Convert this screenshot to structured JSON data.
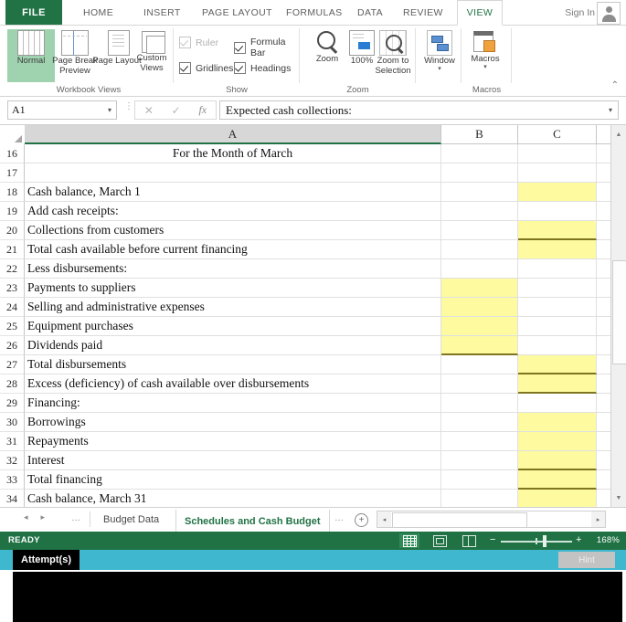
{
  "window": {
    "ribbon_tabs": [
      "FILE",
      "HOME",
      "INSERT",
      "PAGE LAYOUT",
      "FORMULAS",
      "DATA",
      "REVIEW",
      "VIEW"
    ],
    "active_ribbon_tab": "VIEW",
    "sign_in": "Sign In",
    "account_icon": "account-person-icon"
  },
  "ribbon": {
    "groups": [
      {
        "name": "Workbook Views",
        "label": "Workbook Views"
      },
      {
        "name": "Show",
        "label": "Show"
      },
      {
        "name": "Zoom",
        "label": "Zoom"
      },
      {
        "name": "Macros",
        "label": "Macros"
      }
    ],
    "workbook_views": [
      {
        "label": "Normal",
        "icon": "normal-view-icon",
        "selected": true
      },
      {
        "label": "Page Break Preview",
        "icon": "page-break-preview-icon",
        "selected": false
      },
      {
        "label": "Page Layout",
        "icon": "page-layout-icon",
        "selected": false
      },
      {
        "label": "Custom Views",
        "icon": "custom-views-icon",
        "selected": false
      }
    ],
    "show_checkboxes": [
      {
        "label": "Ruler",
        "checked": true,
        "disabled": true
      },
      {
        "label": "Formula Bar",
        "checked": true,
        "disabled": false
      },
      {
        "label": "Gridlines",
        "checked": true,
        "disabled": false
      },
      {
        "label": "Headings",
        "checked": true,
        "disabled": false
      }
    ],
    "zoom_buttons": [
      {
        "label": "Zoom",
        "icon": "magnifier-icon"
      },
      {
        "label": "100%",
        "icon": "zoom-100-icon"
      },
      {
        "label": "Zoom to Selection",
        "icon": "zoom-to-selection-icon"
      }
    ],
    "window_button": {
      "label": "Window",
      "icon": "window-icon",
      "caret": "▾"
    },
    "macros_button": {
      "label": "Macros",
      "icon": "macros-icon",
      "caret": "▾"
    },
    "collapse_icon": "chevron-up-icon"
  },
  "formula_bar": {
    "name_box_value": "A1",
    "name_box_caret": "▾",
    "cancel_icon": "✕",
    "enter_icon": "✓",
    "function_icon": "fx",
    "formula_value": "Expected cash collections:",
    "expand_caret": "▾"
  },
  "grid": {
    "columns": [
      {
        "label": "A",
        "selected": true
      },
      {
        "label": "B",
        "selected": false
      },
      {
        "label": "C",
        "selected": false
      }
    ],
    "rows": [
      {
        "num": "16",
        "a": "For the Month of March",
        "align": "center",
        "b": "",
        "c": "",
        "b_fill": false,
        "c_fill": false,
        "b_top": false,
        "b_bot": false,
        "c_top": false,
        "c_bot": false
      },
      {
        "num": "17",
        "a": "",
        "align": "left",
        "b": "",
        "c": "",
        "b_fill": false,
        "c_fill": false,
        "b_top": false,
        "b_bot": false,
        "c_top": false,
        "c_bot": false
      },
      {
        "num": "18",
        "a": "Cash balance, March 1",
        "align": "left",
        "b": "",
        "c": "",
        "b_fill": false,
        "c_fill": true,
        "b_top": false,
        "b_bot": false,
        "c_top": false,
        "c_bot": false
      },
      {
        "num": "19",
        "a": "Add cash receipts:",
        "align": "left",
        "b": "",
        "c": "",
        "b_fill": false,
        "c_fill": false,
        "b_top": false,
        "b_bot": false,
        "c_top": false,
        "c_bot": false
      },
      {
        "num": "20",
        "a": "   Collections from customers",
        "align": "left",
        "b": "",
        "c": "",
        "b_fill": false,
        "c_fill": true,
        "b_top": false,
        "b_bot": false,
        "c_top": false,
        "c_bot": true
      },
      {
        "num": "21",
        "a": "Total cash available before current financing",
        "align": "left",
        "b": "",
        "c": "",
        "b_fill": false,
        "c_fill": true,
        "b_top": false,
        "b_bot": false,
        "c_top": false,
        "c_bot": false
      },
      {
        "num": "22",
        "a": "Less disbursements:",
        "align": "left",
        "b": "",
        "c": "",
        "b_fill": false,
        "c_fill": false,
        "b_top": false,
        "b_bot": false,
        "c_top": false,
        "c_bot": false
      },
      {
        "num": "23",
        "a": "   Payments to suppliers",
        "align": "left",
        "b": "",
        "c": "",
        "b_fill": true,
        "c_fill": false,
        "b_top": false,
        "b_bot": false,
        "c_top": false,
        "c_bot": false
      },
      {
        "num": "24",
        "a": "   Selling and administrative expenses",
        "align": "left",
        "b": "",
        "c": "",
        "b_fill": true,
        "c_fill": false,
        "b_top": false,
        "b_bot": false,
        "c_top": false,
        "c_bot": false
      },
      {
        "num": "25",
        "a": "   Equipment purchases",
        "align": "left",
        "b": "",
        "c": "",
        "b_fill": true,
        "c_fill": false,
        "b_top": false,
        "b_bot": false,
        "c_top": false,
        "c_bot": false
      },
      {
        "num": "26",
        "a": "   Dividends paid",
        "align": "left",
        "b": "",
        "c": "",
        "b_fill": true,
        "c_fill": false,
        "b_top": false,
        "b_bot": true,
        "c_top": false,
        "c_bot": false
      },
      {
        "num": "27",
        "a": "Total disbursements",
        "align": "left",
        "b": "",
        "c": "",
        "b_fill": false,
        "c_fill": true,
        "b_top": false,
        "b_bot": false,
        "c_top": false,
        "c_bot": true
      },
      {
        "num": "28",
        "a": "Excess (deficiency) of cash available over disbursements",
        "align": "left",
        "b": "",
        "c": "",
        "b_fill": false,
        "c_fill": true,
        "b_top": false,
        "b_bot": false,
        "c_top": false,
        "c_bot": true
      },
      {
        "num": "29",
        "a": "Financing:",
        "align": "left",
        "b": "",
        "c": "",
        "b_fill": false,
        "c_fill": false,
        "b_top": false,
        "b_bot": false,
        "c_top": false,
        "c_bot": false
      },
      {
        "num": "30",
        "a": "   Borrowings",
        "align": "left",
        "b": "",
        "c": "",
        "b_fill": false,
        "c_fill": true,
        "b_top": false,
        "b_bot": false,
        "c_top": false,
        "c_bot": false
      },
      {
        "num": "31",
        "a": "   Repayments",
        "align": "left",
        "b": "",
        "c": "",
        "b_fill": false,
        "c_fill": true,
        "b_top": false,
        "b_bot": false,
        "c_top": false,
        "c_bot": false
      },
      {
        "num": "32",
        "a": "   Interest",
        "align": "left",
        "b": "",
        "c": "",
        "b_fill": false,
        "c_fill": true,
        "b_top": false,
        "b_bot": false,
        "c_top": false,
        "c_bot": true
      },
      {
        "num": "33",
        "a": "Total financing",
        "align": "left",
        "b": "",
        "c": "",
        "b_fill": false,
        "c_fill": true,
        "b_top": false,
        "b_bot": false,
        "c_top": false,
        "c_bot": true
      },
      {
        "num": "34",
        "a": "Cash balance, March 31",
        "align": "left",
        "b": "",
        "c": "",
        "b_fill": false,
        "c_fill": true,
        "b_top": false,
        "b_bot": true,
        "c_top": false,
        "c_bot": true
      }
    ],
    "scroll_up_icon": "▲",
    "scroll_down_icon": "▼"
  },
  "sheet_bar": {
    "first_arrow": "◂",
    "next_arrow": "▸",
    "left_dots": "…",
    "tabs": [
      {
        "label": "Budget Data",
        "active": false
      },
      {
        "label": "Schedules and Cash Budget",
        "active": true
      }
    ],
    "right_dots": "…",
    "add_sheet": "+",
    "hscroll_left": "◂",
    "hscroll_right": "▸"
  },
  "status_bar": {
    "state": "READY",
    "view_buttons": [
      {
        "name": "normal-view",
        "active": true
      },
      {
        "name": "page-layout-view",
        "active": false
      },
      {
        "name": "page-break-view",
        "active": false
      }
    ],
    "zoom_out": "−",
    "zoom_in": "+",
    "zoom_level": "168%"
  },
  "attempt_bar": {
    "label": "Attempt(s)",
    "hint_button": "Hint"
  },
  "colors": {
    "excel_green": "#217346",
    "status_green": "#207245",
    "cell_highlight_yellow": "#fdfaa0",
    "border_olive": "#7f7520",
    "attempt_teal": "#3fb8cf"
  }
}
